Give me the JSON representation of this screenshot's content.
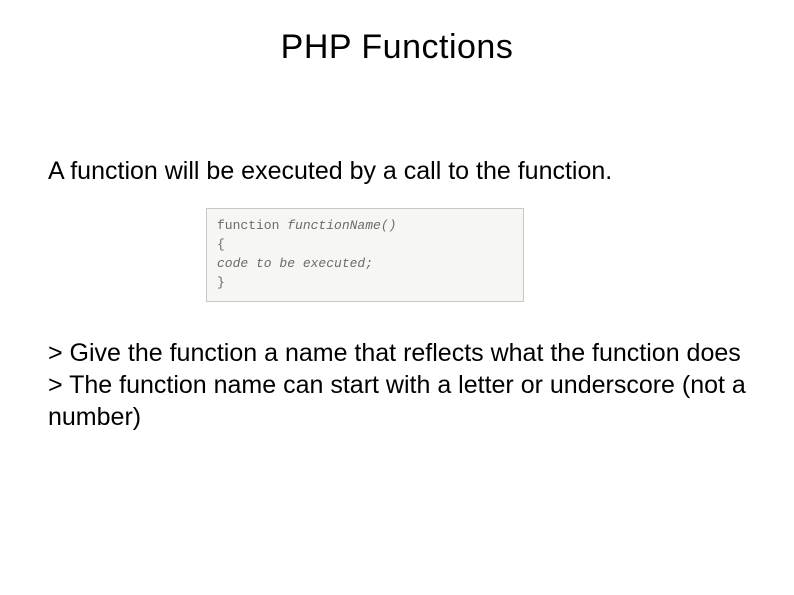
{
  "title": "PHP Functions",
  "intro": "A function will be executed by a call to the function.",
  "code": {
    "line1_kw": "function",
    "line1_name": " functionName()",
    "line2": "{",
    "line3": "code to be executed;",
    "line4": "}"
  },
  "bullets": {
    "b1": "> Give the function a name that reflects what the function does",
    "b2": "> The function name can start with a letter or underscore (not a number)"
  }
}
